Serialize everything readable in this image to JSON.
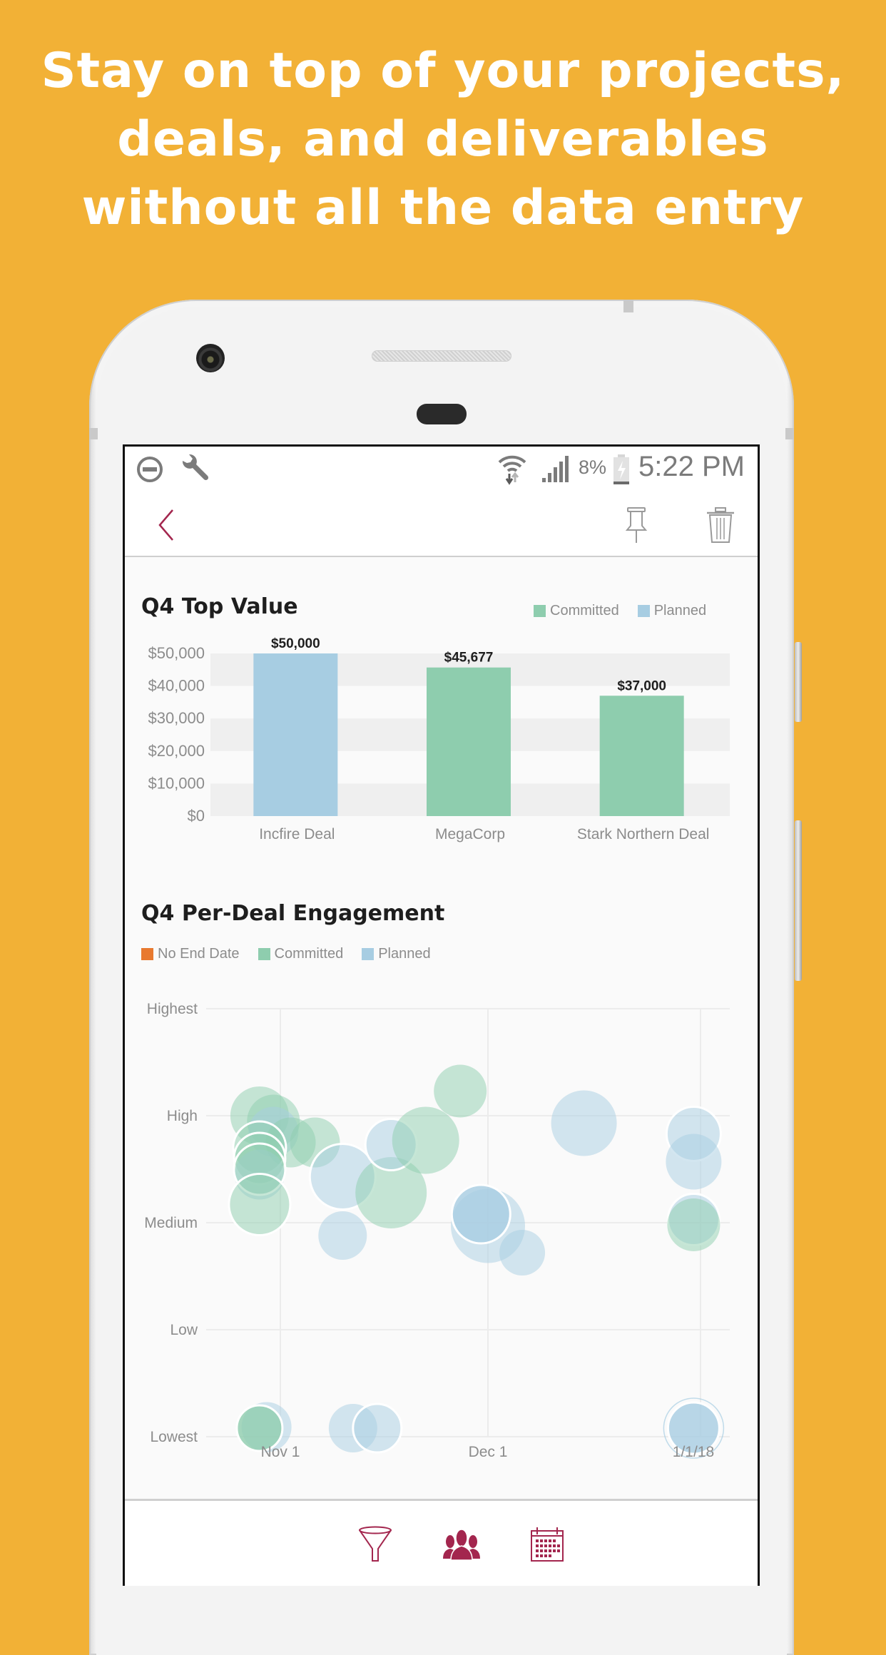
{
  "marketing": {
    "headline_lines": [
      "Stay on top of your projects,",
      "deals, and deliverables",
      "without all the data entry"
    ]
  },
  "status_bar": {
    "left_icons": [
      "do-not-disturb-icon",
      "wrench-icon"
    ],
    "right_icons": [
      "wifi-icon",
      "signal-icon",
      "battery-charging-icon"
    ],
    "battery": "8%",
    "time": "5:22 PM"
  },
  "app_bar": {
    "back_icon": "chevron-left-icon",
    "actions": [
      "pin-icon",
      "trash-icon"
    ]
  },
  "colors": {
    "background": "#F2B136",
    "accent": "#A3264E",
    "committed": "#8ECDAE",
    "planned": "#A7CDE2",
    "no_end_date": "#E8792F"
  },
  "chart_data": [
    {
      "type": "bar",
      "title": "Q4 Top Value",
      "legend": [
        {
          "label": "Committed",
          "color": "#8ECDAE"
        },
        {
          "label": "Planned",
          "color": "#A7CDE2"
        }
      ],
      "legend_position": "top-right",
      "categories": [
        "Incfire Deal",
        "MegaCorp",
        "Stark Northern Deal"
      ],
      "values": [
        50000,
        45677,
        37000
      ],
      "value_labels": [
        "$50,000",
        "$45,677",
        "$37,000"
      ],
      "series_of_bar": [
        "Planned",
        "Committed",
        "Committed"
      ],
      "yticks": [
        0,
        10000,
        20000,
        30000,
        40000,
        50000
      ],
      "ytick_labels": [
        "$0",
        "$10,000",
        "$20,000",
        "$30,000",
        "$40,000",
        "$50,000"
      ],
      "ylim": [
        0,
        50000
      ],
      "xlabel": "",
      "ylabel": "",
      "grid": "alternating bands"
    },
    {
      "type": "scatter",
      "subtype": "bubble",
      "title": "Q4 Per-Deal Engagement",
      "legend": [
        {
          "label": "No End Date",
          "color": "#E8792F"
        },
        {
          "label": "Committed",
          "color": "#8ECDAE"
        },
        {
          "label": "Planned",
          "color": "#A7CDE2"
        }
      ],
      "legend_position": "top-left",
      "ytick_labels": [
        "Lowest",
        "Low",
        "Medium",
        "High",
        "Highest"
      ],
      "ylim": [
        1,
        5
      ],
      "xtick_labels": [
        "Nov 1",
        "Dec 1",
        "1/1/18"
      ],
      "xlim_days_from_nov1": [
        -8,
        62
      ],
      "xticks_days_from_nov1": [
        0,
        30,
        61
      ],
      "grid": true,
      "points": [
        {
          "series": "Committed",
          "x": -3,
          "y": 4.0,
          "size": 41
        },
        {
          "series": "Committed",
          "x": -1,
          "y": 3.95,
          "size": 37
        },
        {
          "series": "Planned",
          "x": -1,
          "y": 3.85,
          "size": 35
        },
        {
          "series": "Committed",
          "x": 1.5,
          "y": 3.75,
          "size": 35
        },
        {
          "series": "Committed",
          "x": 5,
          "y": 3.75,
          "size": 35
        },
        {
          "series": "Committed",
          "x": -3,
          "y": 3.7,
          "size": 37,
          "outlined": true
        },
        {
          "series": "Committed",
          "x": -3,
          "y": 3.6,
          "size": 36,
          "outlined": true
        },
        {
          "series": "Planned",
          "x": -3,
          "y": 3.45,
          "size": 35
        },
        {
          "series": "Committed",
          "x": -3,
          "y": 3.5,
          "size": 36,
          "outlined": true
        },
        {
          "series": "Committed",
          "x": -3,
          "y": 3.17,
          "size": 43,
          "outlined": true
        },
        {
          "series": "Planned",
          "x": 9,
          "y": 3.43,
          "size": 46,
          "outlined": true
        },
        {
          "series": "Committed",
          "x": 16,
          "y": 3.28,
          "size": 50
        },
        {
          "series": "Planned",
          "x": 16,
          "y": 3.73,
          "size": 36,
          "outlined": true
        },
        {
          "series": "Committed",
          "x": 21,
          "y": 3.77,
          "size": 47
        },
        {
          "series": "Committed",
          "x": 26,
          "y": 4.23,
          "size": 37
        },
        {
          "series": "Planned",
          "x": 44,
          "y": 3.93,
          "size": 46
        },
        {
          "series": "Planned",
          "x": 30,
          "y": 2.97,
          "size": 52
        },
        {
          "series": "Planned",
          "x": 29,
          "y": 3.08,
          "size": 41,
          "outlined": true,
          "highlight": true
        },
        {
          "series": "Planned",
          "x": 35,
          "y": 2.72,
          "size": 32
        },
        {
          "series": "Planned",
          "x": 9,
          "y": 2.88,
          "size": 34
        },
        {
          "series": "Planned",
          "x": 60,
          "y": 3.83,
          "size": 38,
          "outlined": true
        },
        {
          "series": "Planned",
          "x": 60,
          "y": 3.57,
          "size": 39
        },
        {
          "series": "Planned",
          "x": 60,
          "y": 3.03,
          "size": 36,
          "outlined": true
        },
        {
          "series": "Committed",
          "x": 60,
          "y": 2.98,
          "size": 37
        },
        {
          "series": "Planned",
          "x": -2,
          "y": 1.09,
          "size": 35
        },
        {
          "series": "Committed",
          "x": -3,
          "y": 1.08,
          "size": 32,
          "outlined": true,
          "highlight": true
        },
        {
          "series": "Planned",
          "x": 10.5,
          "y": 1.08,
          "size": 34
        },
        {
          "series": "Planned",
          "x": 14,
          "y": 1.08,
          "size": 34,
          "outlined": true
        },
        {
          "series": "Planned",
          "x": 60,
          "y": 1.08,
          "size": 36,
          "outlined": true,
          "highlight": true,
          "ring": true
        }
      ]
    }
  ],
  "bottom_nav": {
    "items": [
      "funnel-icon",
      "people-icon",
      "calendar-icon"
    ]
  }
}
